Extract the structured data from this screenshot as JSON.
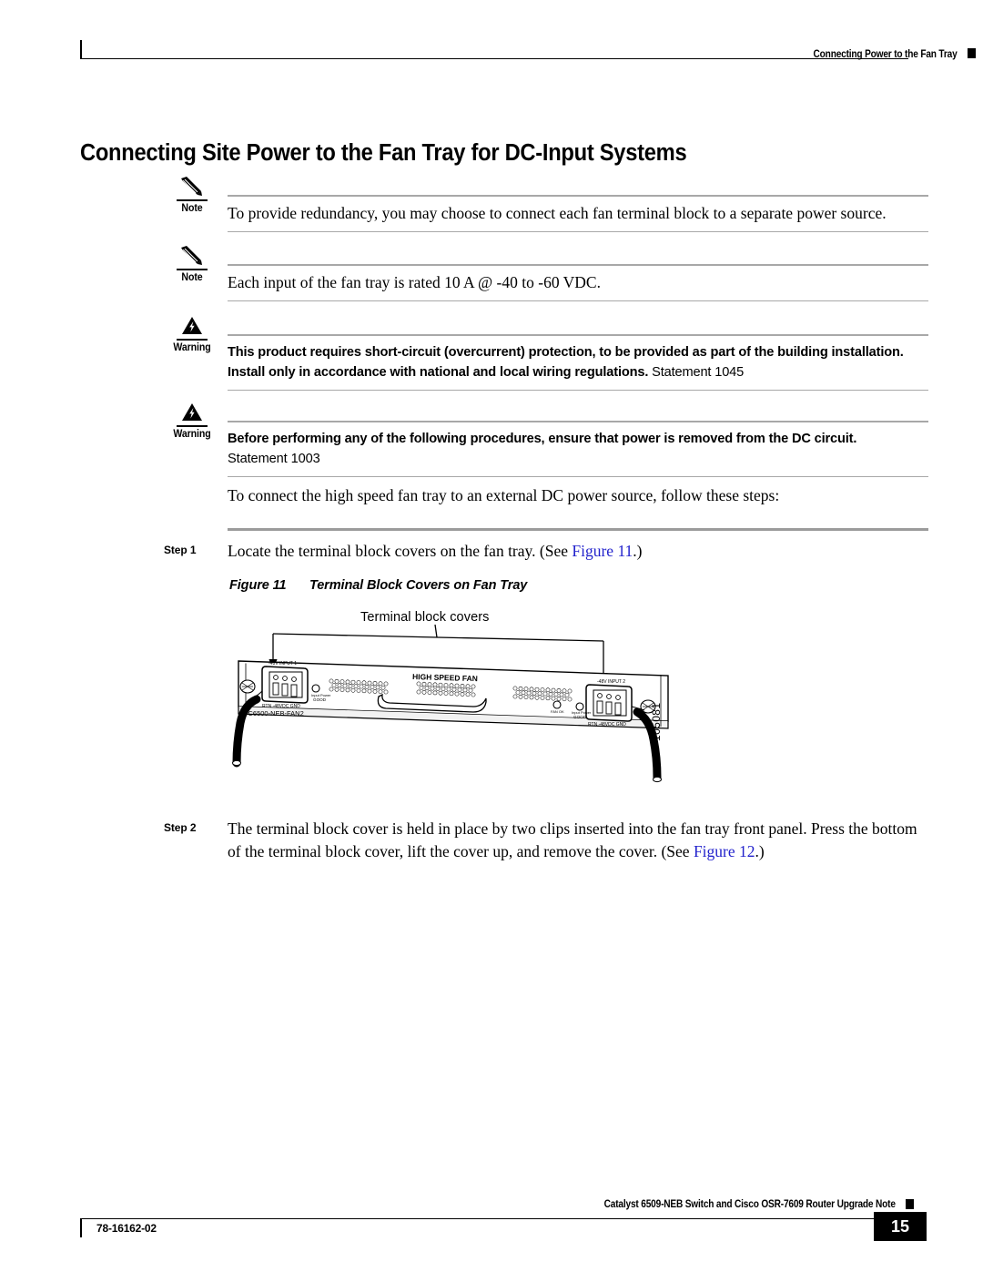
{
  "header": {
    "running_head": "Connecting Power to the Fan Tray"
  },
  "title": "Connecting Site Power to the Fan Tray for DC-Input Systems",
  "admonitions": [
    {
      "label": "Note",
      "icon": "pencil-icon",
      "text": "To provide redundancy, you may choose to connect each fan terminal block to a separate power source."
    },
    {
      "label": "Note",
      "icon": "pencil-icon",
      "text": "Each input of the fan tray is rated 10 A @ -40 to -60 VDC."
    },
    {
      "label": "Warning",
      "icon": "warning-triangle-icon",
      "text": "This product requires short-circuit (overcurrent) protection, to be provided as part of the building installation. Install only in accordance with national and local wiring regulations.",
      "statement": "Statement 1045"
    },
    {
      "label": "Warning",
      "icon": "warning-triangle-icon",
      "text": "Before performing any of the following procedures, ensure that power is removed from the DC circuit.",
      "statement": "Statement 1003"
    }
  ],
  "intro_paragraph": "To connect the high speed fan tray to an external DC power source, follow these steps:",
  "steps": [
    {
      "label": "Step 1",
      "text_before": "Locate the terminal block covers on the fan tray. (See ",
      "xref": "Figure 11",
      "text_after": ".)"
    },
    {
      "label": "Step 2",
      "text_before": "The terminal block cover is held in place by two clips inserted into the fan tray front panel. Press the bottom of the terminal block cover, lift the cover up, and remove the cover. (See ",
      "xref": "Figure 12",
      "text_after": ".)"
    }
  ],
  "figure": {
    "number": "Figure 11",
    "caption": "Terminal Block Covers on Fan Tray",
    "callout": "Terminal block covers",
    "art_id": "105081",
    "panel_labels": {
      "product_id": "-C6500-NEB-FAN2",
      "input1": "-48V INPUT 1",
      "input2": "-48V INPUT 2",
      "wiring": "RTN  -48VDC  GND",
      "fan_name": "HIGH SPEED FAN",
      "led_power": "Input Power GOOD",
      "led_fan": "FAN OK"
    }
  },
  "footer": {
    "doc_number": "78-16162-02",
    "book_title": "Catalyst 6509-NEB Switch and Cisco OSR-7609 Router Upgrade Note",
    "page_number": "15"
  }
}
